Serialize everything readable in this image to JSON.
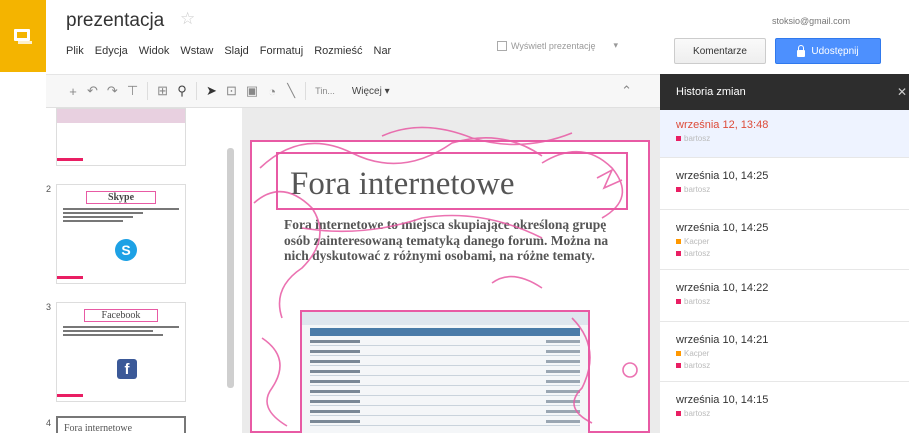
{
  "header": {
    "title": "prezentacja",
    "user_email": "stoksio@gmail.com",
    "menu": [
      "Plik",
      "Edycja",
      "Widok",
      "Wstaw",
      "Slajd",
      "Formatuj",
      "Rozmieść",
      "Nar"
    ],
    "present_label": "Wyświetl prezentację",
    "comment_label": "Komentarze",
    "share_label": "Udostępnij"
  },
  "toolbar": {
    "font_label": "Tin...",
    "more_label": "Więcej"
  },
  "history": {
    "title": "Historia zmian",
    "revisions": [
      {
        "time": "września 12, 13:48",
        "current": true,
        "authors": [
          {
            "name": "bartosz",
            "color": "#e91e63"
          }
        ]
      },
      {
        "time": "września 10, 14:25",
        "current": false,
        "authors": [
          {
            "name": "bartosz",
            "color": "#e91e63"
          }
        ]
      },
      {
        "time": "września 10, 14:25",
        "current": false,
        "authors": [
          {
            "name": "Kacper",
            "color": "#ff9800"
          },
          {
            "name": "bartosz",
            "color": "#e91e63"
          }
        ]
      },
      {
        "time": "września 10, 14:22",
        "current": false,
        "authors": [
          {
            "name": "bartosz",
            "color": "#e91e63"
          }
        ]
      },
      {
        "time": "września 10, 14:21",
        "current": false,
        "authors": [
          {
            "name": "Kacper",
            "color": "#ff9800"
          },
          {
            "name": "bartosz",
            "color": "#e91e63"
          }
        ]
      },
      {
        "time": "września 10, 14:15",
        "current": false,
        "authors": [
          {
            "name": "bartosz",
            "color": "#e91e63"
          }
        ]
      }
    ]
  },
  "filmstrip": {
    "slides": [
      {
        "number": "2",
        "title": "Skype"
      },
      {
        "number": "3",
        "title": "Facebook"
      },
      {
        "number": "4",
        "title": "Fora internetowe"
      }
    ]
  },
  "slide": {
    "title": "Fora internetowe",
    "body": "Fora internetowe to miejsca skupiające określoną grupę osób zainteresowaną tematyką danego forum. Można na nich dyskutować z różnymi osobami, na różne tematy."
  },
  "colors": {
    "brand": "#f4b400",
    "accent_blue": "#4d90fe",
    "annotation_pink": "#e85aa4",
    "current_revision": "#dd4b39"
  },
  "icons": [
    "slides-logo-icon",
    "star-icon",
    "lock-icon",
    "close-icon",
    "skype-icon",
    "facebook-icon"
  ]
}
